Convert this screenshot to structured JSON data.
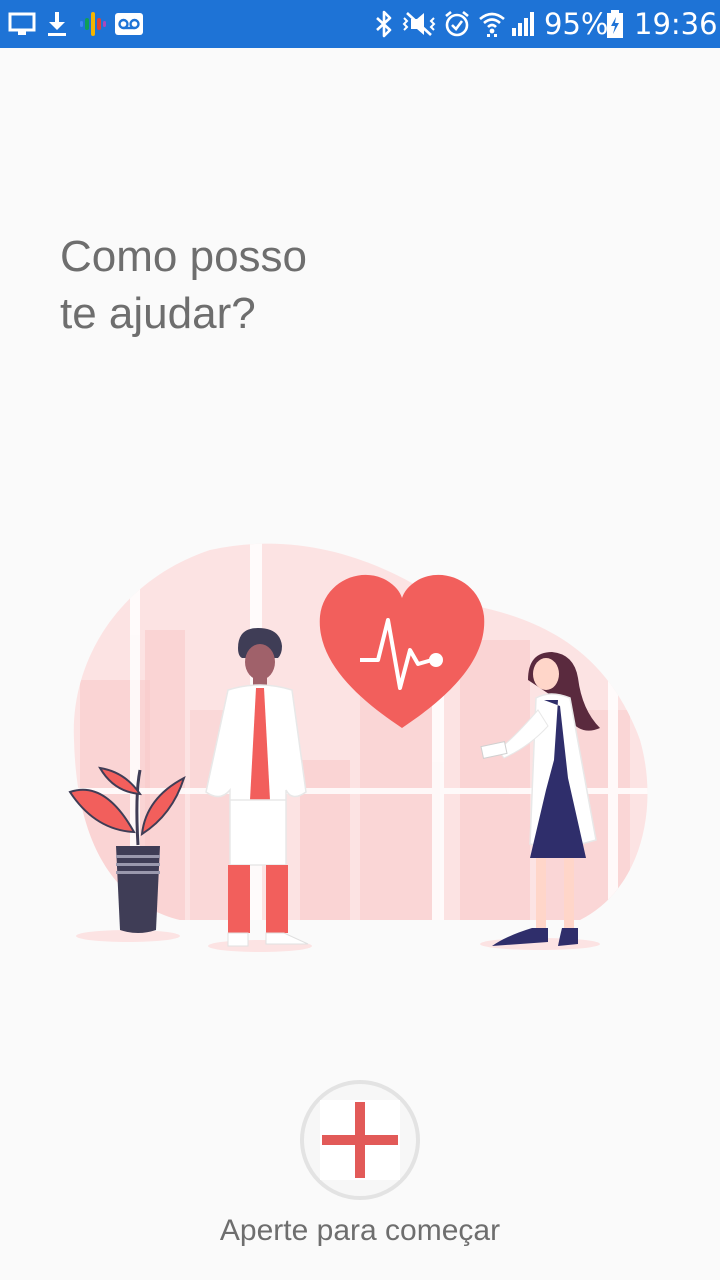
{
  "status_bar": {
    "battery": "95%",
    "time": "19:36",
    "icons": [
      "screen-cast-icon",
      "download-icon",
      "podcast-icon",
      "voicemail-icon",
      "bluetooth-icon",
      "mute-icon",
      "alarm-icon",
      "wifi-icon",
      "signal-icon",
      "battery-charging-icon"
    ]
  },
  "main": {
    "headline_line1": "Como posso",
    "headline_line2": "te ajudar?",
    "start_label": "Aperte para começar",
    "start_icon": "plus-icon"
  },
  "colors": {
    "status_bar": "#1e73d6",
    "accent": "#f25f5c",
    "text": "#6e6e6e",
    "background": "#fafafa"
  }
}
